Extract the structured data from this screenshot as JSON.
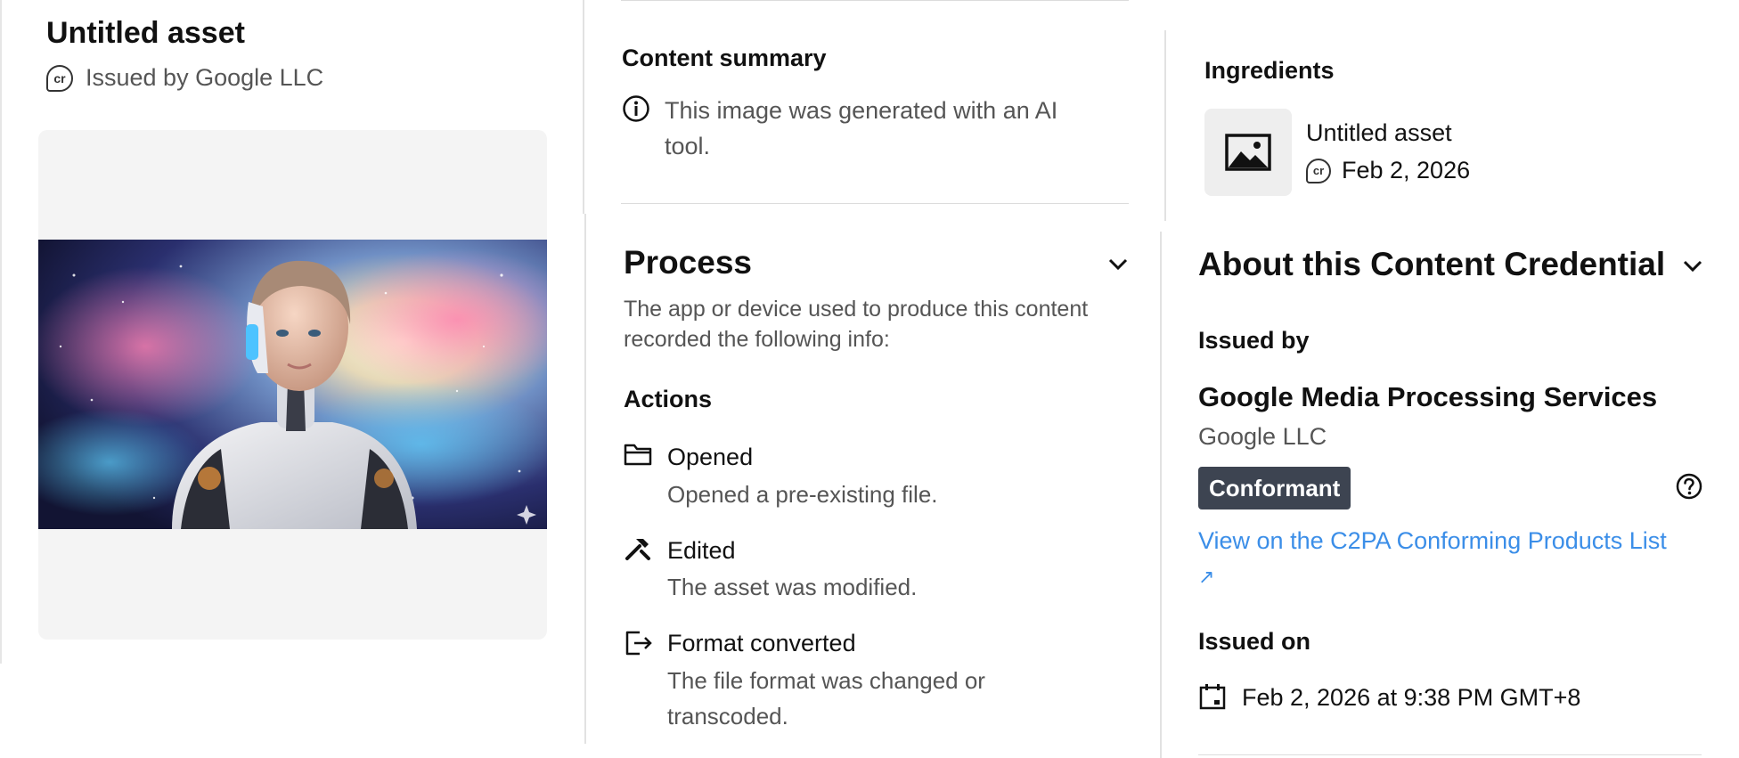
{
  "asset": {
    "title": "Untitled asset",
    "issued_by": "Issued by Google LLC"
  },
  "content_summary": {
    "heading": "Content summary",
    "text": "This image was generated with an AI tool."
  },
  "ingredients": {
    "heading": "Ingredients",
    "item_title": "Untitled asset",
    "item_date": "Feb 2, 2026"
  },
  "process": {
    "heading": "Process",
    "description": "The app or device used to produce this content recorded the following info:",
    "actions_heading": "Actions",
    "actions": [
      {
        "title": "Opened",
        "desc": "Opened a pre-existing file.",
        "icon": "folder-icon"
      },
      {
        "title": "Edited",
        "desc": "The asset was modified.",
        "icon": "tools-icon"
      },
      {
        "title": "Format converted",
        "desc": "The file format was changed or transcoded.",
        "icon": "export-icon"
      }
    ]
  },
  "about": {
    "heading": "About this Content Credential",
    "issued_by_label": "Issued by",
    "issuer_name": "Google Media Processing Services",
    "issuer_org": "Google LLC",
    "badge": "Conformant",
    "link_text": "View on the C2PA Conforming Products List",
    "link_arrow": "↗",
    "issued_on_label": "Issued on",
    "issued_on_value": "Feb 2, 2026 at 9:38 PM GMT+8"
  },
  "colors": {
    "link": "#3b8ee8",
    "badge_bg": "#3d4451",
    "card_bg": "#f4f4f4"
  }
}
